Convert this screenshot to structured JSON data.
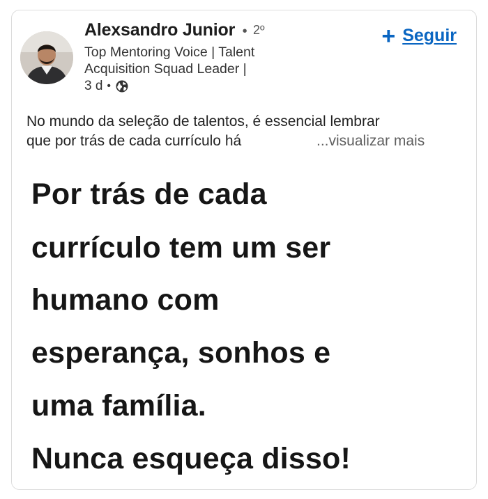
{
  "post": {
    "author": {
      "name": "Alexsandro Junior",
      "degree": "2º",
      "headline": "Top Mentoring Voice | Talent Acquisition Squad Leader |",
      "time": "3 d",
      "visibility_icon": "globe-icon",
      "avatar_icon": "profile-photo"
    },
    "follow_label": "Seguir",
    "text_lines": [
      "No mundo da seleção de talentos, é essencial lembrar",
      "que por trás de cada currículo há"
    ],
    "see_more": "...visualizar mais",
    "image_lines": [
      "Por trás de cada",
      "currículo tem um ser",
      "humano com",
      "esperança, sonhos e",
      "uma família.",
      "Nunca esqueça disso!"
    ]
  },
  "colors": {
    "accent": "#0a66c2",
    "text": "#1d1d1d",
    "muted": "#5f5f5f"
  }
}
